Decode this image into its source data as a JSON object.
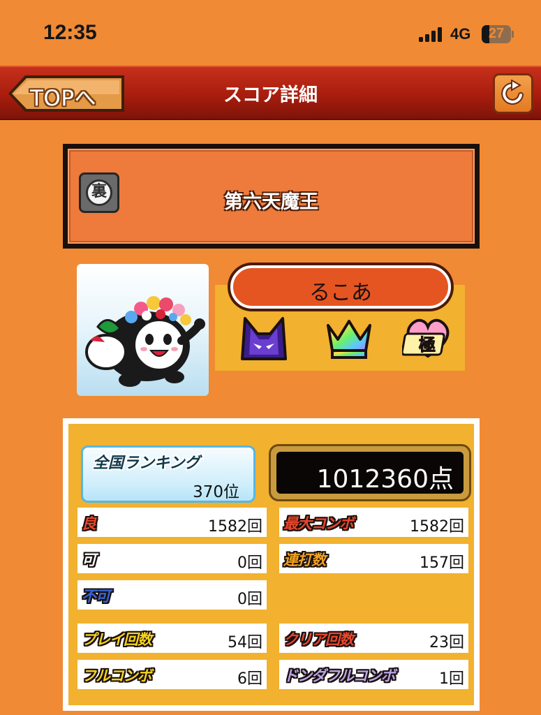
{
  "status_bar": {
    "time": "12:35",
    "network": "4G",
    "battery_percent": 27,
    "battery_text": "27"
  },
  "header": {
    "back_label": "TOPへ",
    "title": "スコア詳細",
    "refresh_icon": "refresh-icon"
  },
  "song": {
    "difficulty_icon": "ura-oni-icon",
    "difficulty_glyph": "裏",
    "title": "第六天魔王"
  },
  "player": {
    "name": "るこあ",
    "avatar": "don-chan-avatar",
    "badges": [
      "devil-rank-icon",
      "rainbow-crown-icon",
      "kiwami-icon"
    ]
  },
  "result": {
    "ranking_label": "全国ランキング",
    "ranking_value": "370位",
    "score": "1012360点",
    "stats_left": [
      {
        "label": "良",
        "value": "1582回",
        "color": "#e8472a"
      },
      {
        "label": "可",
        "value": "0回",
        "color": "#ffffff"
      },
      {
        "label": "不可",
        "value": "0回",
        "color": "#3566d8"
      }
    ],
    "stats_right": [
      {
        "label": "最大コンボ",
        "value": "1582回",
        "color": "#e8472a"
      },
      {
        "label": "連打数",
        "value": "157回",
        "color": "#f0a21e"
      }
    ],
    "counts_left": [
      {
        "label": "プレイ回数",
        "value": "54回",
        "color": "#f5d31c"
      },
      {
        "label": "フルコンボ",
        "value": "6回",
        "color": "#f5d31c"
      }
    ],
    "counts_right": [
      {
        "label": "クリア回数",
        "value": "23回",
        "color": "#e8472a"
      },
      {
        "label": "ドンダフルコンボ",
        "value": "1回",
        "color": "#b9a4e6"
      }
    ]
  },
  "colors": {
    "background": "#f08a34",
    "header": "#a81d0e",
    "panel_yellow": "#f2b12e",
    "name_pill": "#e55522"
  }
}
